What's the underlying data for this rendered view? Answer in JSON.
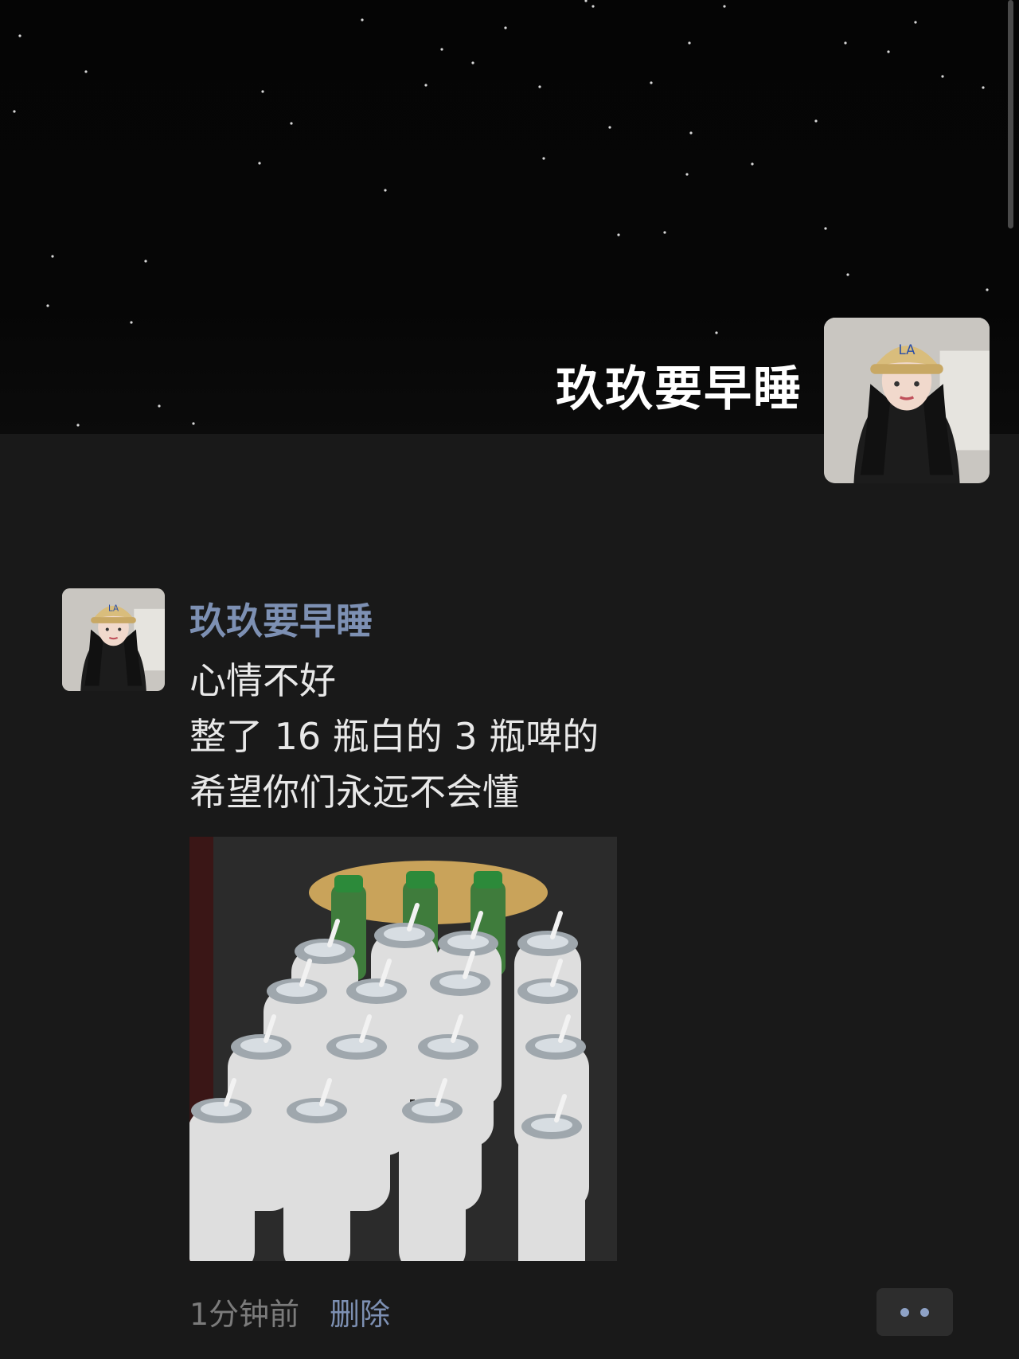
{
  "cover": {
    "user_name": "玖玖要早睡"
  },
  "post": {
    "author": "玖玖要早睡",
    "text_lines": [
      "心情不好",
      "整了 16 瓶白的 3 瓶啤的",
      "希望你们永远不会懂"
    ],
    "time": "1分钟前",
    "delete_label": "删除"
  },
  "icons": {
    "more": "more-dots-icon"
  },
  "colors": {
    "background": "#191919",
    "link_blue": "#7d90b3",
    "text": "#e8e8e8",
    "muted": "#7b7b7b"
  }
}
